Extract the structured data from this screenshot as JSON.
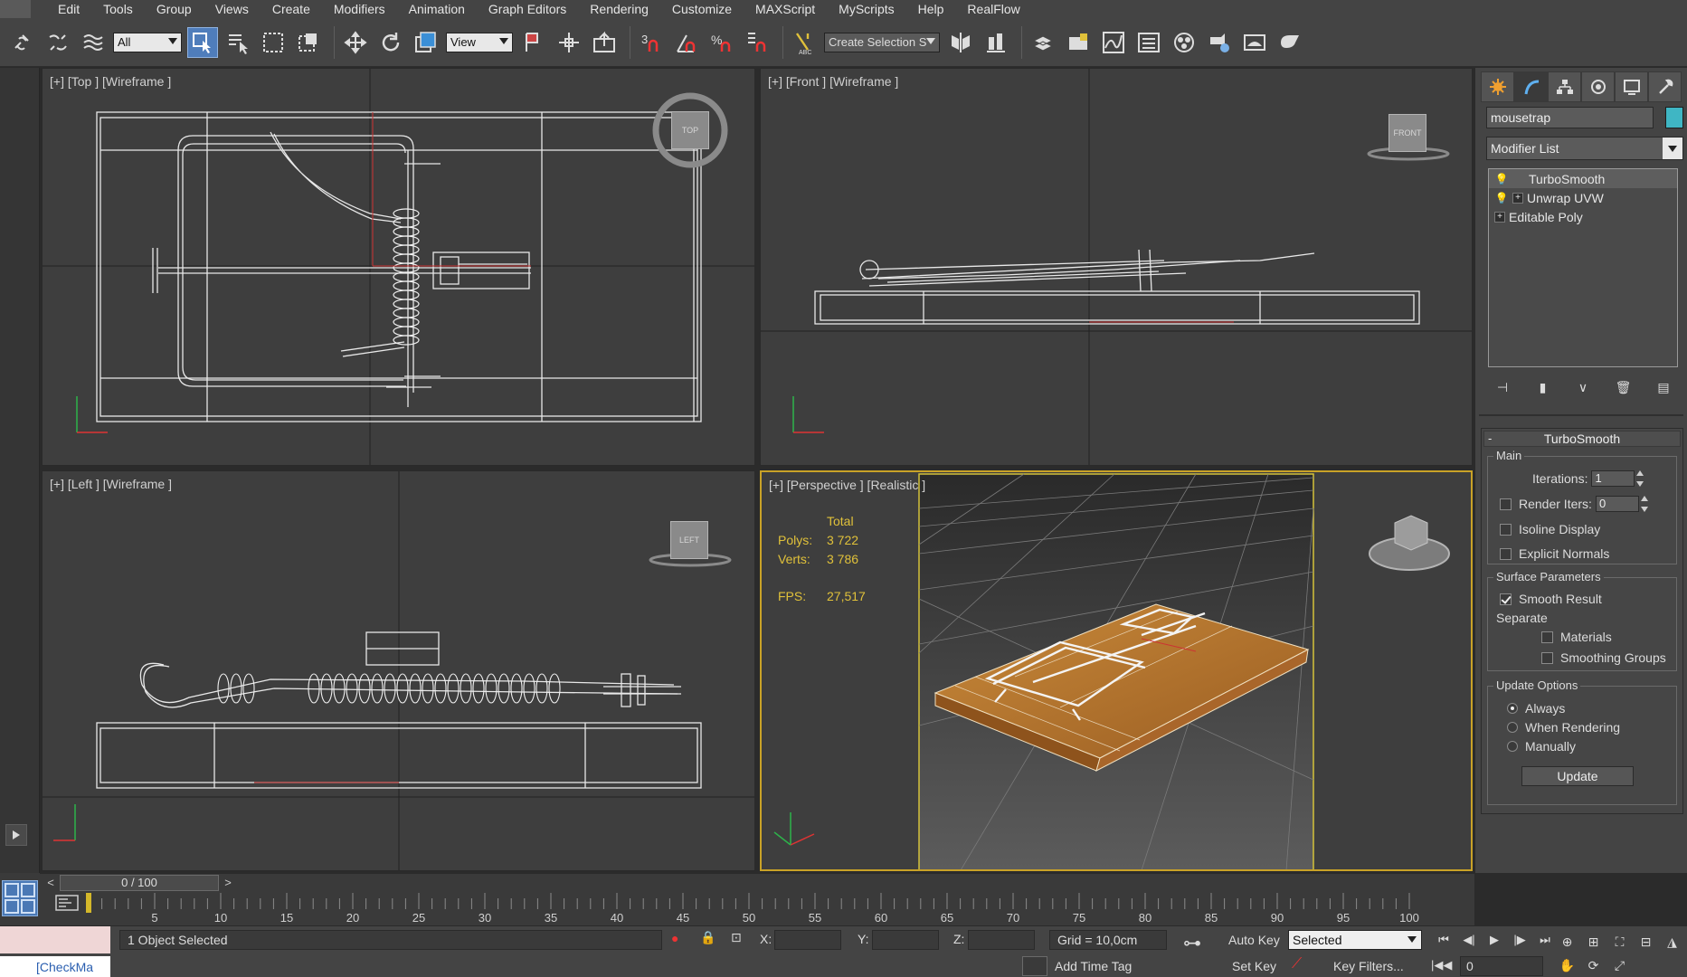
{
  "menu": [
    "Edit",
    "Tools",
    "Group",
    "Views",
    "Create",
    "Modifiers",
    "Animation",
    "Graph Editors",
    "Rendering",
    "Customize",
    "MAXScript",
    "MyScripts",
    "Help",
    "RealFlow"
  ],
  "toolbar": {
    "selection_filter": "All",
    "reference_coord": "View",
    "snap_labels": [
      "3",
      "%"
    ],
    "named_selection_placeholder": "Create Selection Se",
    "icons": [
      "link-icon",
      "unlink-icon",
      "bind-space-warp-icon",
      "select-object-icon",
      "select-by-name-icon",
      "rectangular-selection-icon",
      "window-crossing-icon",
      "move-icon",
      "rotate-icon",
      "scale-icon",
      "pivot-icon",
      "selection-lock-icon",
      "snaps-toggle-icon",
      "angle-snap-icon",
      "percent-snap-icon",
      "spinner-snap-icon",
      "edit-named-selection-icon",
      "mirror-icon",
      "align-icon",
      "layer-manager-icon",
      "graphite-icon",
      "curve-editor-icon",
      "schematic-view-icon",
      "material-editor-icon",
      "render-setup-icon",
      "rendered-frame-icon",
      "render-icon"
    ]
  },
  "viewports": {
    "top": {
      "label": "[+] [Top ] [Wireframe ]",
      "cube": "TOP"
    },
    "front": {
      "label": "[+] [Front ] [Wireframe ]",
      "cube": "FRONT"
    },
    "left": {
      "label": "[+] [Left ] [Wireframe ]",
      "cube": "LEFT"
    },
    "perspective": {
      "label": "[+] [Perspective ] [Realistic ]",
      "stats": {
        "header": "Total",
        "polys_label": "Polys:",
        "polys": "3 722",
        "verts_label": "Verts:",
        "verts": "3 786",
        "fps_label": "FPS:",
        "fps": "27,517"
      }
    }
  },
  "command_panel": {
    "object_name": "mousetrap",
    "object_color": "#3fb6c4",
    "modifier_list": "Modifier List",
    "stack": [
      {
        "name": "TurboSmooth",
        "selected": true,
        "has_plus": false
      },
      {
        "name": "Unwrap UVW",
        "selected": false,
        "has_plus": true
      },
      {
        "name": "Editable Poly",
        "selected": false,
        "has_plus": true
      }
    ],
    "turbosmooth": {
      "title": "TurboSmooth",
      "main_group": "Main",
      "iterations_label": "Iterations:",
      "iterations": "1",
      "render_iters_label": "Render Iters:",
      "render_iters": "0",
      "render_iters_checked": false,
      "isoline_label": "Isoline Display",
      "isoline_checked": false,
      "explicit_normals_label": "Explicit Normals",
      "explicit_normals_checked": false,
      "surface_group": "Surface Parameters",
      "smooth_result_label": "Smooth Result",
      "smooth_result_checked": true,
      "separate_label": "Separate",
      "materials_label": "Materials",
      "materials_checked": false,
      "smoothing_groups_label": "Smoothing Groups",
      "smoothing_groups_checked": false,
      "update_group": "Update Options",
      "options": [
        {
          "label": "Always",
          "selected": true
        },
        {
          "label": "When Rendering",
          "selected": false
        },
        {
          "label": "Manually",
          "selected": false
        }
      ],
      "update_button": "Update"
    }
  },
  "timeline": {
    "slider_text": "0 / 100",
    "prev": "<",
    "next": ">",
    "tick_labels": [
      "5",
      "10",
      "15",
      "20",
      "25",
      "30",
      "35",
      "40",
      "45",
      "50",
      "55",
      "60",
      "65",
      "70",
      "75",
      "80",
      "85",
      "90",
      "95",
      "100"
    ]
  },
  "status": {
    "script_name": "[CheckMa",
    "selection_text": "1 Object Selected",
    "x_label": "X:",
    "y_label": "Y:",
    "z_label": "Z:",
    "grid": "Grid = 10,0cm",
    "add_time_tag": "Add Time Tag",
    "auto_key": "Auto Key",
    "set_key": "Set Key",
    "key_mode": "Selected",
    "key_filters": "Key Filters...",
    "current_frame": "0"
  },
  "colors": {
    "accent": "#4f7dbb",
    "active_viewport_border": "#c9a227",
    "stats_text": "#e0c13a",
    "wood": "#b5742c"
  }
}
